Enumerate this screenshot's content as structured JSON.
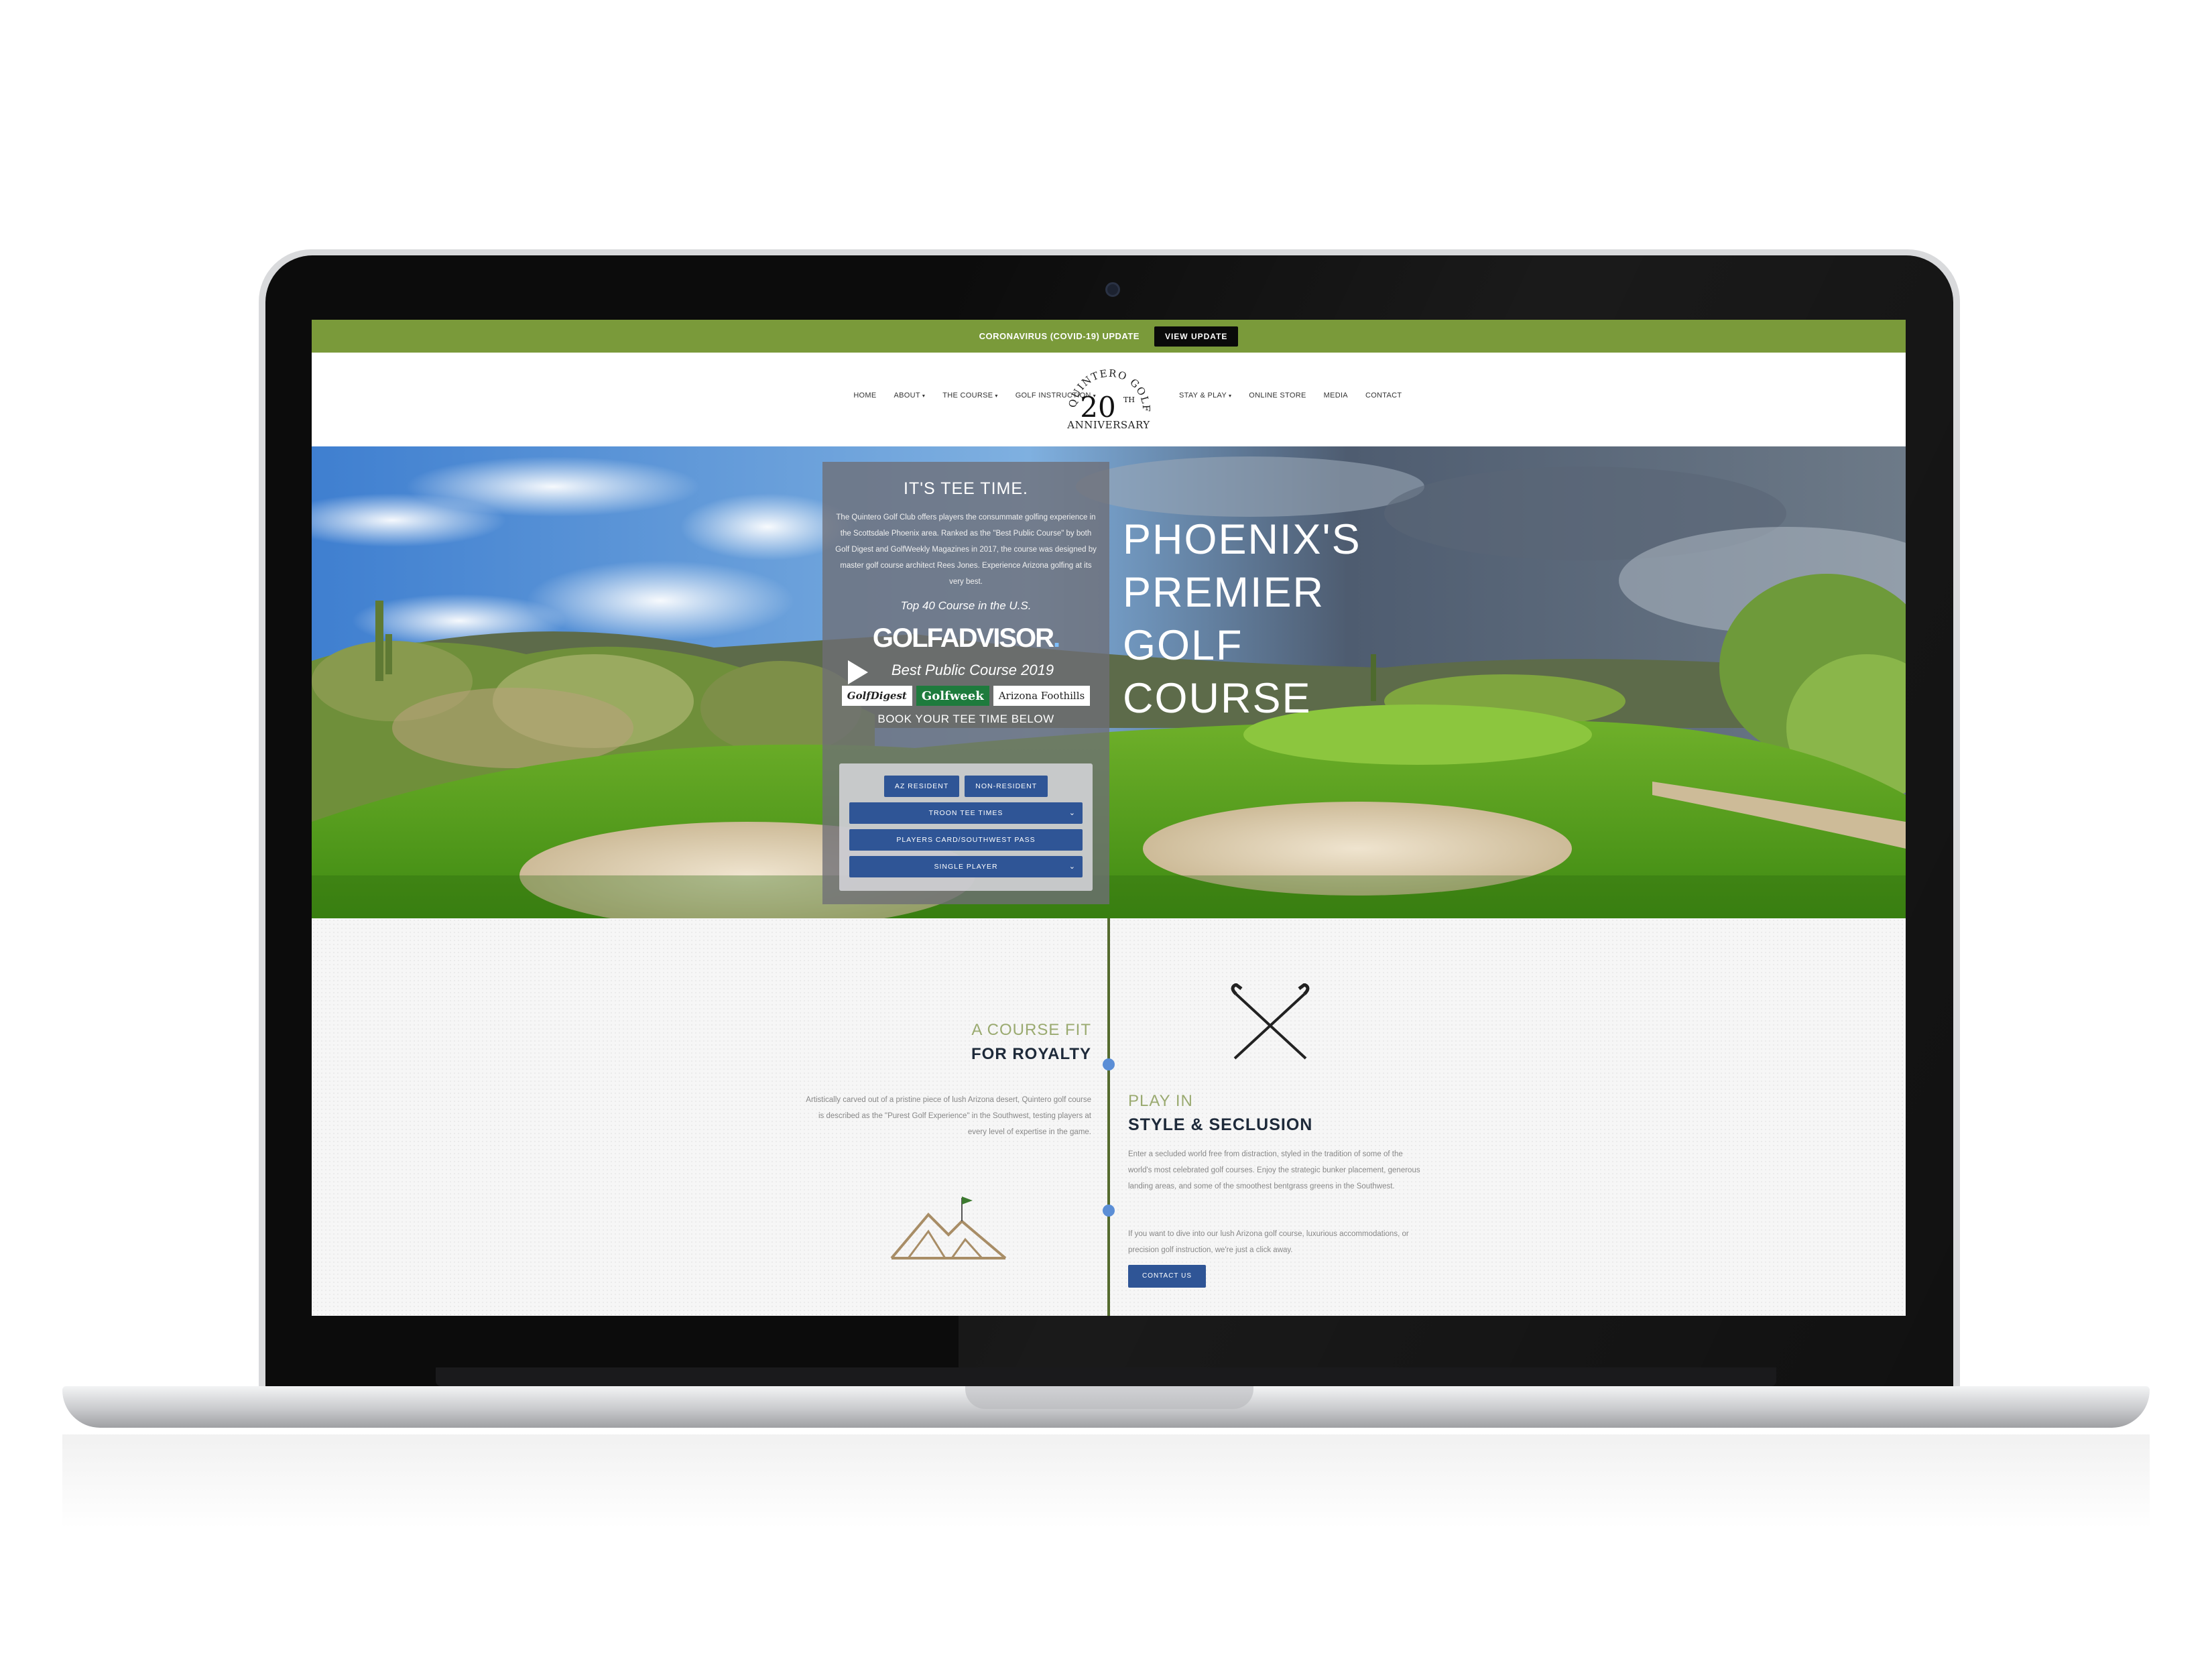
{
  "banner": {
    "text": "CORONAVIRUS (COVID-19) UPDATE",
    "button": "VIEW UPDATE"
  },
  "nav": {
    "left": [
      {
        "label": "HOME",
        "dropdown": false
      },
      {
        "label": "ABOUT",
        "dropdown": true
      },
      {
        "label": "THE COURSE",
        "dropdown": true
      },
      {
        "label": "GOLF INSTRUCTION",
        "dropdown": true
      }
    ],
    "right": [
      {
        "label": "STAY & PLAY",
        "dropdown": true
      },
      {
        "label": "ONLINE STORE",
        "dropdown": false
      },
      {
        "label": "MEDIA",
        "dropdown": false
      },
      {
        "label": "CONTACT",
        "dropdown": false
      }
    ]
  },
  "logo": {
    "arc_text": "QUINTERO GOLF CLUB",
    "number": "20",
    "suffix": "TH",
    "anniversary": "ANNIVERSARY"
  },
  "hero": {
    "panel_title": "IT'S TEE TIME.",
    "panel_desc": "The Quintero Golf Club offers players the consummate golfing experience in the Scottsdale Phoenix area. Ranked as the \"Best Public Course\" by both Golf Digest and GolfWeekly Magazines in 2017, the course was designed by master golf course architect Rees Jones. Experience Arizona golfing at its very best.",
    "top40": "Top 40 Course in the U.S.",
    "golfadvisor": "GOLFADVISOR",
    "best_public": "Best Public Course 2019",
    "magazines": [
      "GolfDigest",
      "Golfweek",
      "Arizona Foothills"
    ],
    "book_text": "BOOK YOUR TEE TIME BELOW",
    "tabs": [
      "AZ RESIDENT",
      "NON-RESIDENT"
    ],
    "selects": [
      {
        "label": "TROON TEE TIMES",
        "chevron": true
      },
      {
        "label": "PLAYERS CARD/SOUTHWEST PASS",
        "chevron": false
      },
      {
        "label": "SINGLE PLAYER",
        "chevron": true
      }
    ],
    "headline": [
      "PHOENIX'S",
      "PREMIER",
      "GOLF",
      "COURSE"
    ]
  },
  "royalty": {
    "small": "A COURSE FIT",
    "big": "FOR ROYALTY",
    "desc": "Artistically carved out of a pristine piece of lush Arizona desert, Quintero golf course is described as the \"Purest Golf Experience\" in the Southwest, testing players at every level of expertise in the game."
  },
  "style": {
    "small": "PLAY IN",
    "big": "STYLE & SECLUSION",
    "desc": "Enter a secluded world free from distraction, styled in the tradition of some of the world's most celebrated golf courses. Enjoy the strategic bunker placement, generous landing areas, and some of the smoothest bentgrass greens in the Southwest.",
    "desc2": "If you want to dive into our lush Arizona golf course, luxurious accommodations, or precision golf instruction, we're just a click away.",
    "button": "CONTACT US"
  },
  "colors": {
    "banner_green": "#7a9a3a",
    "button_blue": "#2f5596",
    "divider_green": "#556b2f",
    "accent_olive": "#9aaa70",
    "timeline_dot": "#5b8ed6"
  },
  "icons": [
    "play-icon",
    "crossed-golf-clubs-icon",
    "mountain-flag-icon",
    "chevron-down-icon"
  ]
}
